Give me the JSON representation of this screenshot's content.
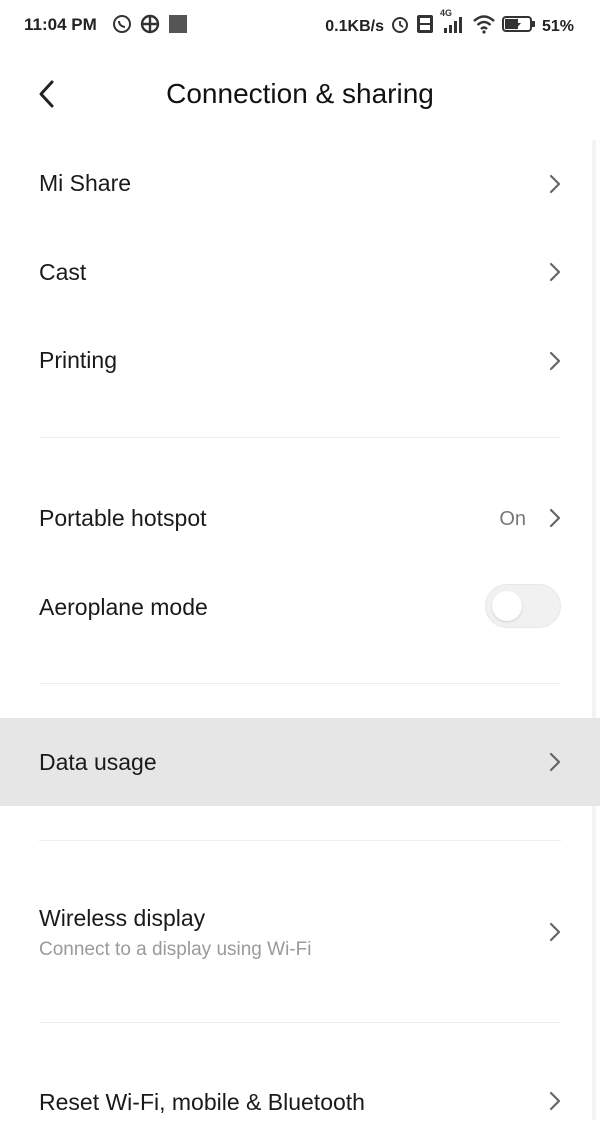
{
  "status_bar": {
    "time": "11:04 PM",
    "speed": "0.1KB/s",
    "network": "4G",
    "battery": "51%"
  },
  "header": {
    "title": "Connection & sharing"
  },
  "items": [
    {
      "label": "Mi Share"
    },
    {
      "label": "Cast"
    },
    {
      "label": "Printing"
    },
    {
      "label": "Portable hotspot",
      "value": "On"
    },
    {
      "label": "Aeroplane mode",
      "toggle": false
    },
    {
      "label": "Data usage"
    },
    {
      "label": "Wireless display",
      "sub": "Connect to a display using Wi-Fi"
    },
    {
      "label": "Reset Wi-Fi, mobile & Bluetooth"
    }
  ],
  "colors": {
    "highlight": "#e6e6e6",
    "divider": "#ececec",
    "subtext": "#9a9a9a"
  }
}
